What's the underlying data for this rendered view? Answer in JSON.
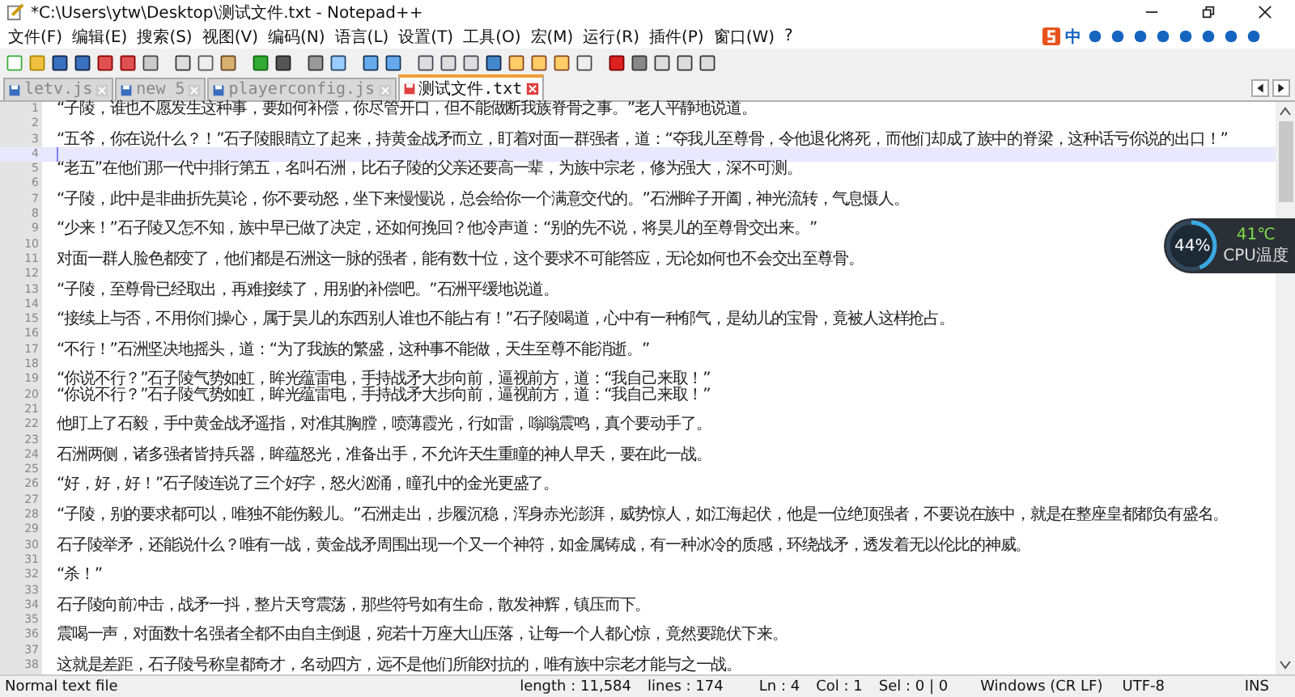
{
  "window": {
    "title": "*C:\\Users\\ytw\\Desktop\\测试文件.txt - Notepad++"
  },
  "menu": [
    "文件(F)",
    "编辑(E)",
    "搜索(S)",
    "视图(V)",
    "编码(N)",
    "语言(L)",
    "设置(T)",
    "工具(O)",
    "宏(M)",
    "运行(R)",
    "插件(P)",
    "窗口(W)",
    "?"
  ],
  "ime_toolbar": {
    "mode": "中"
  },
  "tabs": [
    {
      "label": "letv.js",
      "selected": false,
      "modified": false
    },
    {
      "label": "new 5",
      "selected": false,
      "modified": false
    },
    {
      "label": "playerconfig.js",
      "selected": false,
      "modified": false
    },
    {
      "label": "测试文件.txt",
      "selected": true,
      "modified": true
    }
  ],
  "editor": {
    "lines": [
      {
        "number": "1",
        "current": false,
        "text": "“子陵，谁也不愿发生这种事，要如何补偿，你尽管开口，但不能做断我族脊骨之事。”老人平静地说道。"
      },
      {
        "number": "2",
        "current": false
      },
      {
        "number": "3",
        "current": false,
        "text": "“五爷，你在说什么？！”石子陵眼睛立了起来，持黄金战矛而立，盯着对面一群强者，道：“夺我儿至尊骨，令他退化将死，而他们却成了族中的脊梁，这种话亏你说的出口！”"
      },
      {
        "number": "4",
        "current": true
      },
      {
        "number": "5",
        "current": false,
        "text": "“老五”在他们那一代中排行第五，名叫石洲，比石子陵的父亲还要高一辈，为族中宗老，修为强大，深不可测。"
      },
      {
        "number": "6",
        "current": false
      },
      {
        "number": "7",
        "current": false,
        "text": "“子陵，此中是非曲折先莫论，你不要动怒，坐下来慢慢说，总会给你一个满意交代的。”石洲眸子开阖，神光流转，气息慑人。"
      },
      {
        "number": "8",
        "current": false
      },
      {
        "number": "9",
        "current": false,
        "text": "“少来！”石子陵又怎不知，族中早已做了决定，还如何挽回？他冷声道：“别的先不说，将昊儿的至尊骨交出来。”"
      },
      {
        "number": "10",
        "current": false
      },
      {
        "number": "11",
        "current": false,
        "text": "对面一群人脸色都变了，他们都是石洲这一脉的强者，能有数十位，这个要求不可能答应，无论如何也不会交出至尊骨。"
      },
      {
        "number": "12",
        "current": false
      },
      {
        "number": "13",
        "current": false,
        "text": "“子陵，至尊骨已经取出，再难接续了，用别的补偿吧。”石洲平缓地说道。"
      },
      {
        "number": "14",
        "current": false
      },
      {
        "number": "15",
        "current": false,
        "text": "“接续上与否，不用你们操心，属于昊儿的东西别人谁也不能占有！”石子陵喝道，心中有一种郁气，是幼儿的宝骨，竟被人这样抢占。"
      },
      {
        "number": "16",
        "current": false
      },
      {
        "number": "17",
        "current": false,
        "text": "“不行！”石洲坚决地摇头，道：“为了我族的繁盛，这种事不能做，天生至尊不能消逝。”"
      },
      {
        "number": "18",
        "current": false
      },
      {
        "number": "19",
        "current": false,
        "text": "“你说不行？”石子陵气势如虹，眸光蕴雷电，手持战矛大步向前，逼视前方，道：“我自己来取！”"
      },
      {
        "number": "20",
        "current": false,
        "text": "“你说不行？”石子陵气势如虹，眸光蕴雷电，手持战矛大步向前，逼视前方，道：“我自己来取！”"
      },
      {
        "number": "21",
        "current": false
      },
      {
        "number": "22",
        "current": false,
        "text": "他盯上了石毅，手中黄金战矛遥指，对准其胸膛，喷薄霞光，行如雷，嗡嗡震鸣，真个要动手了。"
      },
      {
        "number": "23",
        "current": false
      },
      {
        "number": "24",
        "current": false,
        "text": "石洲两侧，诸多强者皆持兵器，眸蕴怒光，准备出手，不允许天生重瞳的神人早夭，要在此一战。"
      },
      {
        "number": "25",
        "current": false
      },
      {
        "number": "26",
        "current": false,
        "text": "“好，好，好！”石子陵连说了三个好字，怒火汹涌，瞳孔中的金光更盛了。"
      },
      {
        "number": "27",
        "current": false
      },
      {
        "number": "28",
        "current": false,
        "text": "“子陵，别的要求都可以，唯独不能伤毅儿。”石洲走出，步履沉稳，浑身赤光澎湃，威势惊人，如江海起伏，他是一位绝顶强者，不要说在族中，就是在整座皇都都负有盛名。"
      },
      {
        "number": "29",
        "current": false
      },
      {
        "number": "30",
        "current": false,
        "text": "石子陵举矛，还能说什么？唯有一战，黄金战矛周围出现一个又一个神符，如金属铸成，有一种冰冷的质感，环绕战矛，透发着无以伦比的神威。"
      },
      {
        "number": "31",
        "current": false
      },
      {
        "number": "32",
        "current": false,
        "text": "“杀！”"
      },
      {
        "number": "33",
        "current": false
      },
      {
        "number": "34",
        "current": false,
        "text": "石子陵向前冲击，战矛一抖，整片天穹震荡，那些符号如有生命，散发神辉，镇压而下。"
      },
      {
        "number": "35",
        "current": false
      },
      {
        "number": "36",
        "current": false,
        "text": "震喝一声，对面数十名强者全都不由自主倒退，宛若十万座大山压落，让每一个人都心惊，竟然要跪伏下来。"
      },
      {
        "number": "37",
        "current": false
      },
      {
        "number": "38",
        "current": false,
        "text": "这就是差距，石子陵号称皇都奇才，名动四方，远不是他们所能对抗的，唯有族中宗老才能与之一战。"
      }
    ]
  },
  "cpu_widget": {
    "usage": "44%",
    "temperature": "41℃",
    "label": "CPU温度",
    "level": 0.44
  },
  "status_bar": {
    "file_type": "Normal text file",
    "length": "length : 11,584",
    "lines": "lines : 174",
    "ln": "Ln : 4",
    "col": "Col : 1",
    "sel": "Sel : 0 | 0",
    "eol": "Windows (CR LF)",
    "encoding": "UTF-8",
    "mode": "INS"
  }
}
